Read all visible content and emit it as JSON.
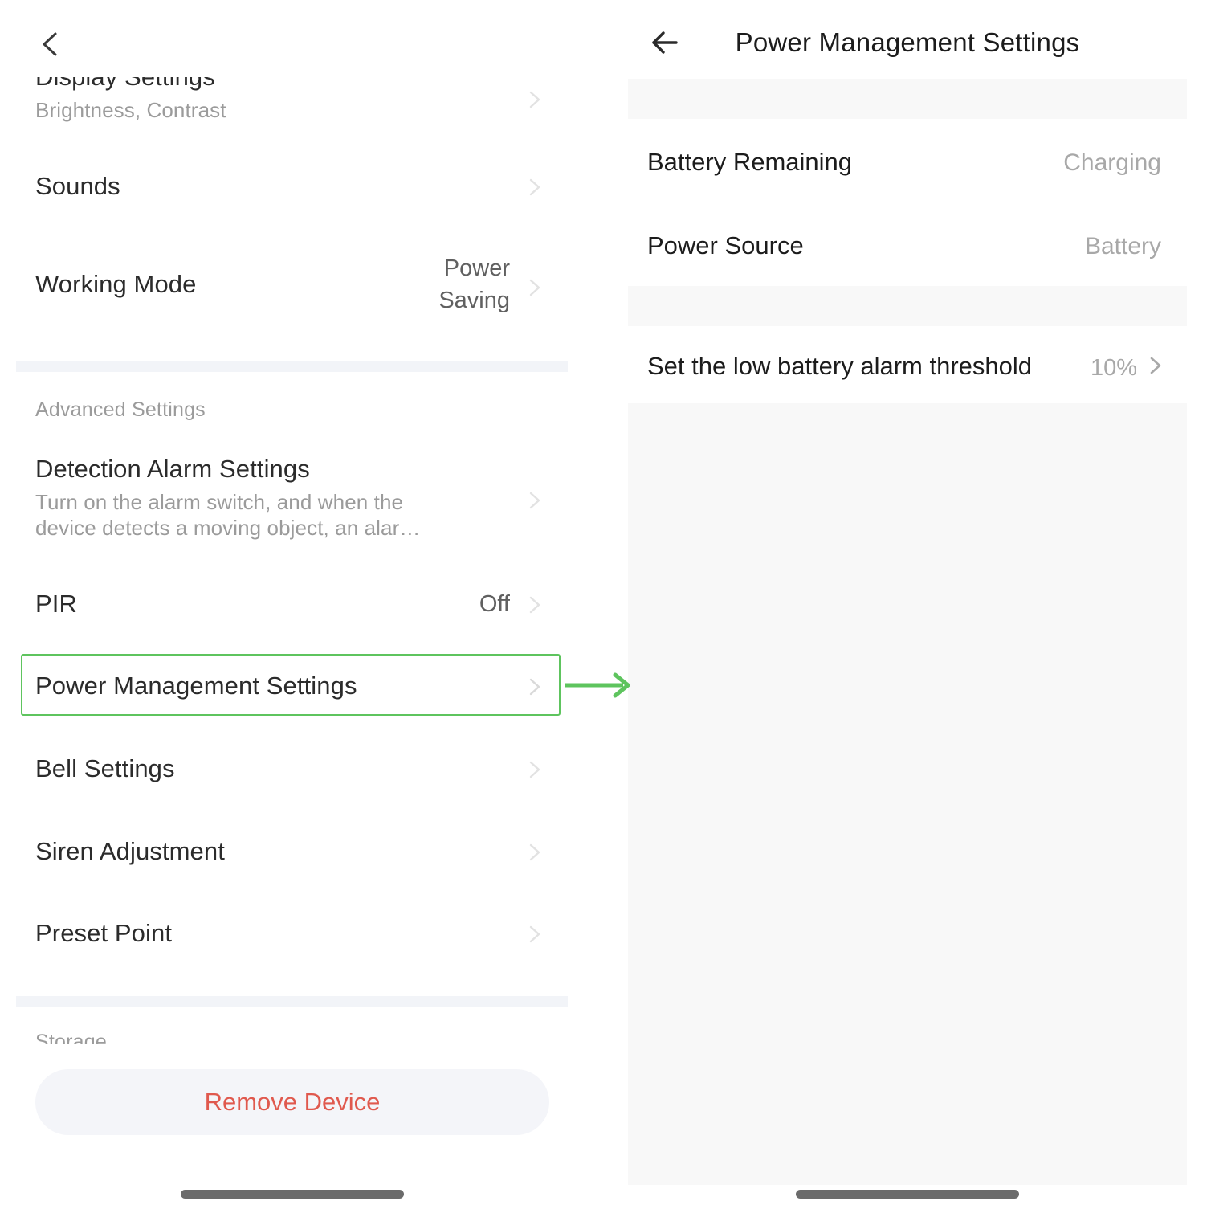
{
  "left_panel": {
    "nav": {
      "back_icon": "chevron-left-icon"
    },
    "items": [
      {
        "label": "Display Settings",
        "sublabel": "Brightness, Contrast",
        "value": "",
        "chevron": "chevron-right-icon"
      },
      {
        "label": "Sounds",
        "sublabel": "",
        "value": "",
        "chevron": "chevron-right-icon"
      },
      {
        "label": "Working Mode",
        "sublabel": "",
        "value_line1": "Power",
        "value_line2": "Saving",
        "chevron": "chevron-right-icon"
      }
    ],
    "advanced_section": {
      "title": "Advanced Settings",
      "items": [
        {
          "label": "Detection Alarm Settings",
          "sub_line1": "Turn on the alarm switch, and when the",
          "sub_line2": "device detects a moving object, an alar…",
          "chevron": "chevron-right-icon"
        },
        {
          "label": "PIR",
          "value": "Off",
          "chevron": "chevron-right-icon"
        },
        {
          "label": "Power Management Settings",
          "value": "",
          "chevron": "chevron-right-icon",
          "highlighted": true
        },
        {
          "label": "Bell Settings",
          "value": "",
          "chevron": "chevron-right-icon"
        },
        {
          "label": "Siren Adjustment",
          "value": "",
          "chevron": "chevron-right-icon"
        },
        {
          "label": "Preset Point",
          "value": "",
          "chevron": "chevron-right-icon"
        }
      ]
    },
    "storage_section": {
      "title": "Storage"
    },
    "remove_device_label": "Remove Device"
  },
  "annotation": {
    "highlight_color": "#5ec45e",
    "arrow_color": "#5ec45e",
    "arrow_icon": "arrow-right-icon"
  },
  "right_panel": {
    "nav": {
      "back_icon": "arrow-left-icon",
      "title": "Power Management Settings"
    },
    "rows": [
      {
        "label": "Battery Remaining",
        "value": "Charging",
        "chevron": ""
      },
      {
        "label": "Power Source",
        "value": "Battery",
        "chevron": ""
      }
    ],
    "threshold_row": {
      "label": "Set the low battery alarm threshold",
      "value": "10%",
      "chevron": "chevron-right-icon"
    }
  },
  "colors": {
    "accent_green": "#5ec45e",
    "danger_red": "#e0594e",
    "band_gray": "#f2f4f8",
    "panel_gray": "#f8f8f8",
    "muted_text": "#9b9b9b"
  }
}
